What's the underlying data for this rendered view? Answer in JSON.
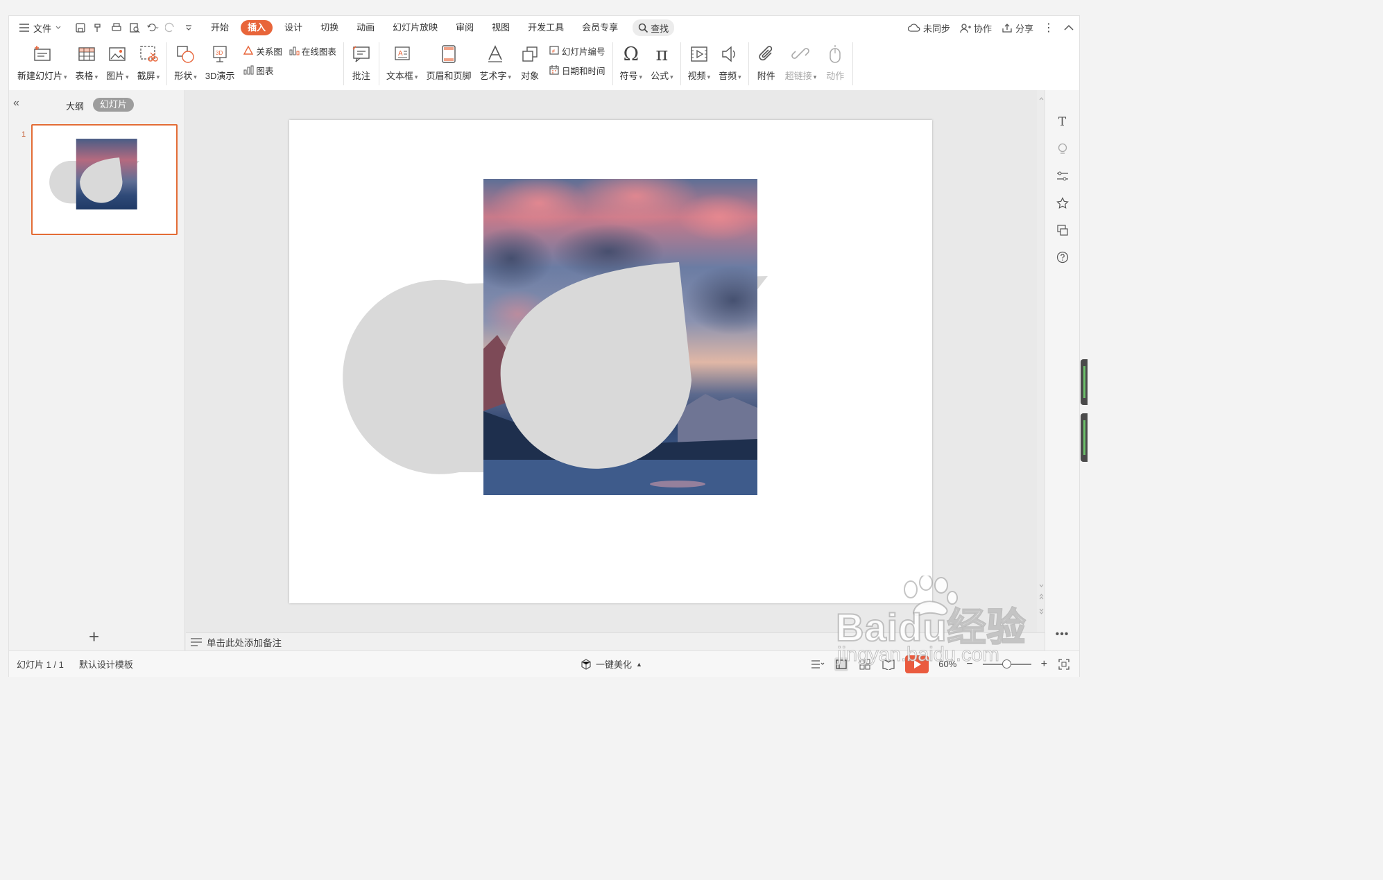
{
  "menu": {
    "file": "文件",
    "tabs": [
      "开始",
      "插入",
      "设计",
      "切换",
      "动画",
      "幻灯片放映",
      "审阅",
      "视图",
      "开发工具",
      "会员专享"
    ],
    "active_tab": "插入",
    "search": "查找",
    "right": {
      "sync": "未同步",
      "collab": "协作",
      "share": "分享"
    }
  },
  "ribbon": {
    "new_slide": "新建幻灯片",
    "table": "表格",
    "picture": "图片",
    "screenshot": "截屏",
    "shape": "形状",
    "demo3d": "3D演示",
    "smartart": "关系图",
    "online_chart": "在线图表",
    "chart": "图表",
    "comment": "批注",
    "textbox": "文本框",
    "header_footer": "页眉和页脚",
    "wordart": "艺术字",
    "object": "对象",
    "slide_number": "幻灯片编号",
    "date_time": "日期和时间",
    "symbol": "符号",
    "formula": "公式",
    "video": "视频",
    "audio": "音频",
    "attachment": "附件",
    "hyperlink": "超链接",
    "action": "动作"
  },
  "left_pane": {
    "tab_outline": "大纲",
    "tab_slides": "幻灯片",
    "slide_number": "1"
  },
  "notes_placeholder": "单击此处添加备注",
  "status": {
    "slide_info": "幻灯片 1 / 1",
    "template": "默认设计模板",
    "beautify": "一键美化",
    "zoom": "60%"
  },
  "watermark": {
    "brand": "Baidu经验",
    "url": "jingyan.baidu.com"
  },
  "colors": {
    "accent": "#e8653a",
    "shape_fill": "#d9d9d9"
  }
}
